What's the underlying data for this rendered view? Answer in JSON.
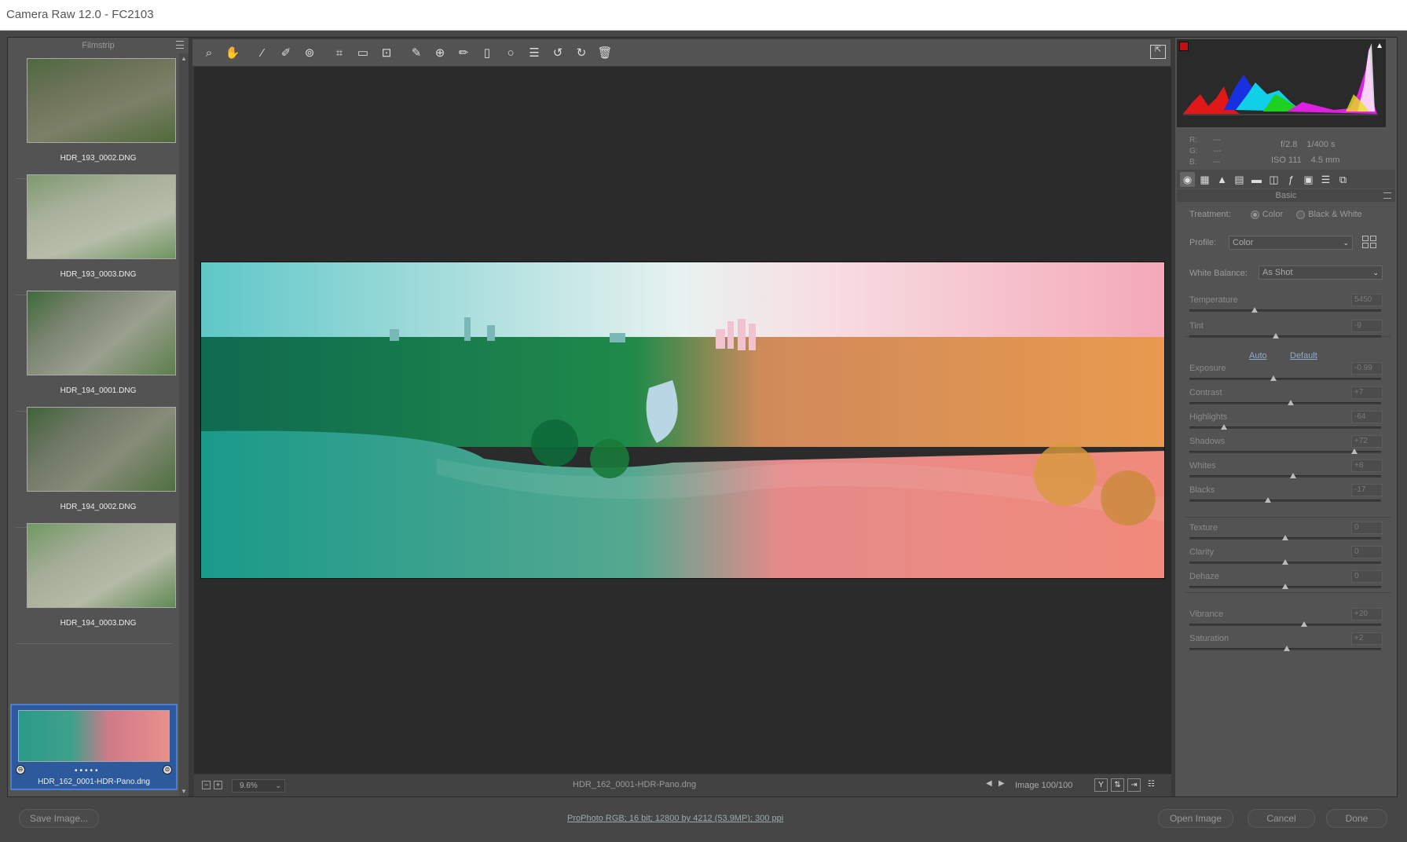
{
  "window": {
    "title": "Camera Raw 12.0  -  FC2103"
  },
  "filmstrip": {
    "title": "Filmstrip",
    "items": [
      {
        "label": "HDR_193_0002.DNG"
      },
      {
        "label": "HDR_193_0003.DNG"
      },
      {
        "label": "HDR_194_0001.DNG"
      },
      {
        "label": "HDR_194_0002.DNG"
      },
      {
        "label": "HDR_194_0003.DNG"
      },
      {
        "label": "HDR_162_0001-HDR-Pano.dng",
        "selected": true
      }
    ]
  },
  "toolbar": {
    "tools": [
      "zoom-tool-icon",
      "hand-tool-icon",
      "white-balance-tool-icon",
      "color-sampler-tool-icon",
      "targeted-adjustment-tool-icon",
      "crop-tool-icon",
      "straighten-tool-icon",
      "transform-tool-icon",
      "spot-removal-tool-icon",
      "red-eye-tool-icon",
      "adjustment-brush-icon",
      "graduated-filter-icon",
      "radial-filter-icon",
      "presets-list-icon",
      "rotate-left-icon",
      "rotate-right-icon",
      "trash-icon"
    ]
  },
  "preview": {
    "filename": "HDR_162_0001-HDR-Pano.dng",
    "zoom": "9.6%",
    "image_count": "Image 100/100"
  },
  "histogram": {
    "rgb": {
      "r_label": "R:",
      "g_label": "G:",
      "b_label": "B:",
      "r": "---",
      "g": "---",
      "b": "---"
    },
    "exif": {
      "aperture": "f/2.8",
      "shutter": "1/400 s",
      "iso": "ISO 111",
      "focal": "4.5 mm"
    }
  },
  "panel": {
    "title": "Basic",
    "treatment_label": "Treatment:",
    "treatment_options": [
      "Color",
      "Black & White"
    ],
    "profile_label": "Profile:",
    "profile_value": "Color",
    "wb_label": "White Balance:",
    "wb_value": "As Shot",
    "auto": "Auto",
    "default": "Default",
    "sliders": [
      {
        "label": "Temperature",
        "value": "5450",
        "pos": 0.34
      },
      {
        "label": "Tint",
        "value": "-9",
        "pos": 0.45
      },
      {
        "label": "Exposure",
        "value": "-0.99",
        "pos": 0.44
      },
      {
        "label": "Contrast",
        "value": "+7",
        "pos": 0.53
      },
      {
        "label": "Highlights",
        "value": "-64",
        "pos": 0.18
      },
      {
        "label": "Shadows",
        "value": "+72",
        "pos": 0.86
      },
      {
        "label": "Whites",
        "value": "+8",
        "pos": 0.54
      },
      {
        "label": "Blacks",
        "value": "-17",
        "pos": 0.41
      },
      {
        "label": "Texture",
        "value": "0",
        "pos": 0.5
      },
      {
        "label": "Clarity",
        "value": "0",
        "pos": 0.5
      },
      {
        "label": "Dehaze",
        "value": "0",
        "pos": 0.5
      },
      {
        "label": "Vibrance",
        "value": "+20",
        "pos": 0.6
      },
      {
        "label": "Saturation",
        "value": "+2",
        "pos": 0.51
      }
    ]
  },
  "bottom": {
    "save": "Save Image...",
    "workflow": "ProPhoto RGB; 16 bit; 12800 by 4212 (53.9MP); 300 ppi",
    "open": "Open Image",
    "cancel": "Cancel",
    "done": "Done"
  },
  "colors": {
    "accent": "#2c5a9c",
    "link": "#8fa9c9"
  }
}
